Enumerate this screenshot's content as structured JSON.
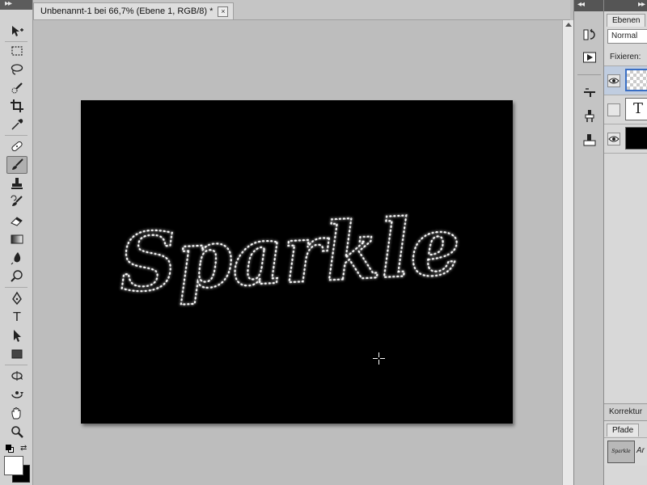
{
  "document": {
    "tab_title": "Unbenannt-1 bei 66,7% (Ebene 1, RGB/8) *",
    "close_symbol": "×"
  },
  "canvas": {
    "artwork_text": "Sparkle",
    "background_color": "#000000",
    "sparkle_color": "#ffffff"
  },
  "tools": [
    {
      "name": "move-tool-icon"
    },
    {
      "name": "rectangular-marquee-icon"
    },
    {
      "name": "lasso-icon"
    },
    {
      "name": "quick-selection-icon"
    },
    {
      "name": "crop-icon"
    },
    {
      "name": "eyedropper-icon"
    },
    {
      "name": "spot-healing-icon"
    },
    {
      "name": "brush-icon",
      "active": true
    },
    {
      "name": "clone-stamp-icon"
    },
    {
      "name": "history-brush-icon"
    },
    {
      "name": "eraser-icon"
    },
    {
      "name": "gradient-icon"
    },
    {
      "name": "blur-icon"
    },
    {
      "name": "dodge-icon"
    },
    {
      "name": "pen-icon"
    },
    {
      "name": "type-tool-icon",
      "glyph": "T"
    },
    {
      "name": "path-selection-icon"
    },
    {
      "name": "rectangle-shape-icon"
    },
    {
      "name": "3d-rotate-icon"
    },
    {
      "name": "3d-orbit-icon"
    },
    {
      "name": "hand-icon"
    },
    {
      "name": "zoom-icon"
    }
  ],
  "colors": {
    "foreground": "#ffffff",
    "background": "#000000"
  },
  "panels": {
    "layers_tab": "Ebenen",
    "blend_mode": "Normal",
    "lock_label": "Fixieren:",
    "layer_text_thumb": "T",
    "adjustments_tab": "Korrektur",
    "paths_tab": "Pfade",
    "path_thumb_text": "Sparkle",
    "path_name_partial": "Ar"
  }
}
